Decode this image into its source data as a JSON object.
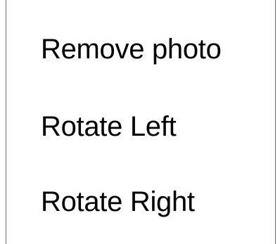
{
  "context_menu": {
    "items": [
      {
        "label": "Remove photo"
      },
      {
        "label": "Rotate Left"
      },
      {
        "label": "Rotate Right"
      }
    ]
  }
}
